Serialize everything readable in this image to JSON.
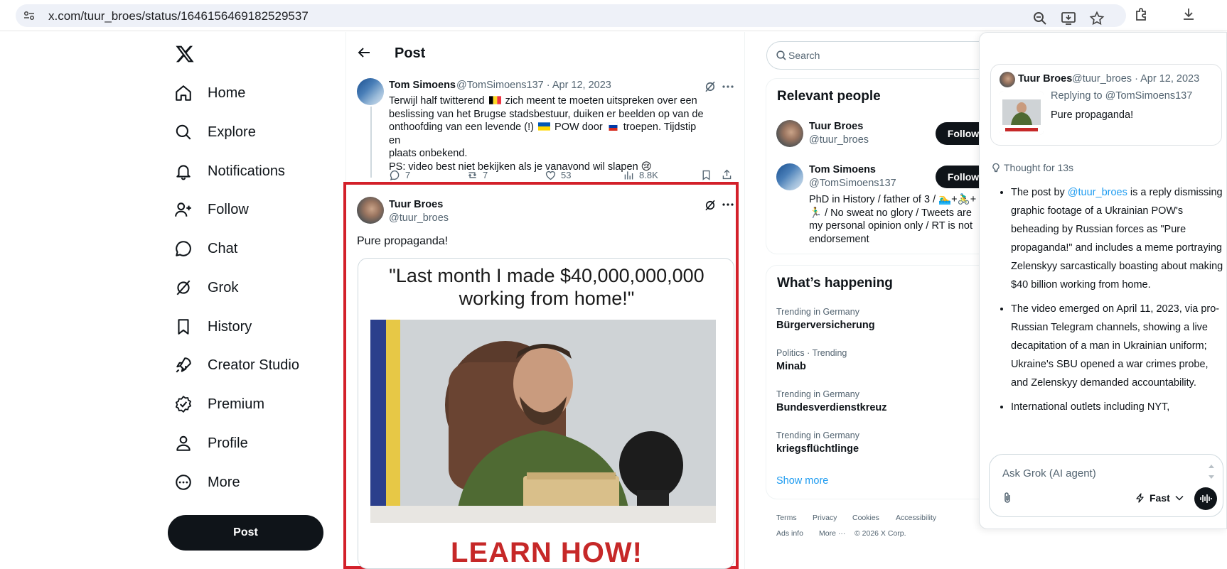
{
  "browser": {
    "url": "x.com/tuur_broes/status/1646156469182529537"
  },
  "nav": {
    "items": [
      {
        "label": "Home"
      },
      {
        "label": "Explore"
      },
      {
        "label": "Notifications"
      },
      {
        "label": "Follow"
      },
      {
        "label": "Chat"
      },
      {
        "label": "Grok"
      },
      {
        "label": "History"
      },
      {
        "label": "Creator Studio"
      },
      {
        "label": "Premium"
      },
      {
        "label": "Profile"
      },
      {
        "label": "More"
      }
    ],
    "post_button": "Post"
  },
  "main": {
    "title": "Post",
    "parent_tweet": {
      "name": "Tom Simoens",
      "handle": "@TomSimoens137",
      "date": "Apr 12, 2023",
      "text_1": "Terwijl half twitterend",
      "text_2": "zich meent te moeten uitspreken over een",
      "text_3": "beslissing van het Brugse stadsbestuur, duiken er beelden op van de",
      "text_4": "onthoofding van een levende (!)",
      "text_5": "POW door",
      "text_6": "troepen. Tijdstip en",
      "text_7": "plaats onbekend.",
      "text_8": "PS: video best niet bekijken als je vanavond wil slapen 😢",
      "replies": "7",
      "reposts": "7",
      "likes": "53",
      "views": "8.8K"
    },
    "reply_tweet": {
      "name": "Tuur Broes",
      "handle": "@tuur_broes",
      "text": "Pure propaganda!",
      "meme_quote": "\"Last month I made $40,000,000,000 working from home!\"",
      "meme_cta": "LEARN HOW!"
    }
  },
  "sidebar": {
    "search_placeholder": "Search",
    "relevant_title": "Relevant people",
    "people": [
      {
        "name": "Tuur Broes",
        "handle": "@tuur_broes",
        "follow": "Follow",
        "bio": ""
      },
      {
        "name": "Tom Simoens",
        "handle": "@TomSimoens137",
        "follow": "Follow",
        "bio_1": "PhD in History / father of 3 / 🏊‍♂️+🚴‍♂️+",
        "bio_2": "🏃‍♂️ / No sweat no glory / Tweets are",
        "bio_3": "my personal opinion only / RT is not",
        "bio_4": "endorsement"
      }
    ],
    "happening_title": "What’s happening",
    "trends": [
      {
        "category": "Trending in Germany",
        "name": "Bürgerversicherung"
      },
      {
        "category": "Politics · Trending",
        "name": "Minab"
      },
      {
        "category": "Trending in Germany",
        "name": "Bundesverdienstkreuz"
      },
      {
        "category": "Trending in Germany",
        "name": "kriegsflüchtlinge"
      }
    ],
    "show_more": "Show more",
    "footer": {
      "terms": "Terms",
      "privacy": "Privacy",
      "cookies": "Cookies",
      "accessibility": "Accessibility",
      "ads": "Ads info",
      "more": "More ···",
      "copyright": "© 2026 X Corp."
    }
  },
  "grok": {
    "quote": {
      "name": "Tuur Broes",
      "handle": "@tuur_broes",
      "date": "Apr 12, 2023",
      "replying": "Replying to @TomSimoens137",
      "text": "Pure propaganda!"
    },
    "thought": "Thought for 13s",
    "bullet1_pre": "The post by ",
    "bullet1_link": "@tuur_broes",
    "bullet1_post": " is a reply dismissing graphic footage of a Ukrainian POW's beheading by Russian forces as \"Pure propaganda!\" and includes a meme portraying Zelenskyy sarcastically boasting about making $40 billion working from home.",
    "bullet2": "The video emerged on April 11, 2023, via pro-Russian Telegram channels, showing a live decapitation of a man in Ukrainian uniform; Ukraine's SBU opened a war crimes probe, and Zelenskyy demanded accountability.",
    "bullet3": "International outlets including NYT,",
    "ask_placeholder": "Ask Grok (AI agent)",
    "mode": "Fast"
  },
  "colors": {
    "accent": "#1d9bf0",
    "highlight_border": "#d3202a",
    "text": "#0f1419",
    "muted": "#536471"
  }
}
